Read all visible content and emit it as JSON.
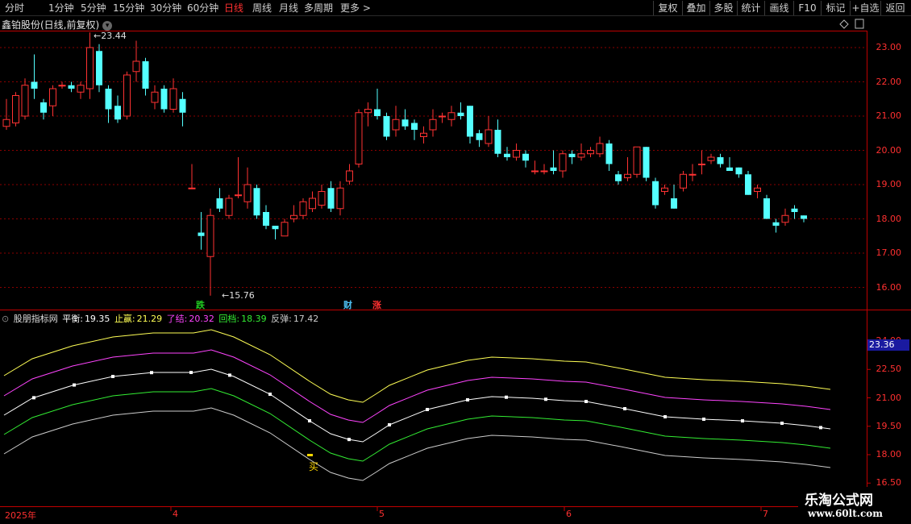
{
  "toolbar": {
    "timeframes": [
      "分时",
      "1分钟",
      "5分钟",
      "15分钟",
      "30分钟",
      "60分钟",
      "日线",
      "周线",
      "月线",
      "多周期",
      "更多 >"
    ],
    "active_timeframe": "日线",
    "right_buttons": [
      "复权",
      "叠加",
      "多股",
      "统计",
      "画线",
      "F10",
      "标记",
      "+自选",
      "返回"
    ]
  },
  "chart_title": {
    "name": "鑫铂股份(日线,前复权)",
    "dropdown_icon": "chevron-down-icon"
  },
  "top_right_icons": [
    "diamond-icon",
    "panel-icon"
  ],
  "price_axis": [
    "23.00",
    "22.00",
    "21.00",
    "20.00",
    "19.00",
    "18.00",
    "17.00",
    "16.00"
  ],
  "annotations": {
    "high": "23.44",
    "low": "15.76"
  },
  "event_flags": [
    {
      "text": "跌",
      "color": "#22cc22"
    },
    {
      "text": "财",
      "color": "#4fc3f7"
    },
    {
      "text": "涨",
      "color": "#ff3030"
    }
  ],
  "indicator": {
    "name": "股朋指标网",
    "fields": [
      {
        "label": "平衡:",
        "value": "19.35",
        "color": "#ffffff"
      },
      {
        "label": "止赢:",
        "value": "21.29",
        "color": "#ffff55"
      },
      {
        "label": "了结:",
        "value": "20.32",
        "color": "#ff44ff"
      },
      {
        "label": "回档:",
        "value": "18.39",
        "color": "#33ee33"
      },
      {
        "label": "反弹:",
        "value": "17.42",
        "color": "#cccccc"
      }
    ],
    "axis": [
      "24.00",
      "22.50",
      "21.00",
      "19.50",
      "18.00",
      "16.50"
    ],
    "current_value": "23.36",
    "signal": "买"
  },
  "date_axis": [
    "2025年",
    "4",
    "5",
    "6",
    "7"
  ],
  "watermark": {
    "line1": "乐淘公式网",
    "line2": "www.60lt.com"
  },
  "colors": {
    "up": "#ff3232",
    "down": "#54ffff",
    "grid": "#8b0000",
    "balance": "#ffffff",
    "take_profit": "#ffff55",
    "close_out": "#ff44ff",
    "pullback": "#33ee33",
    "rebound": "#cccccc"
  }
}
